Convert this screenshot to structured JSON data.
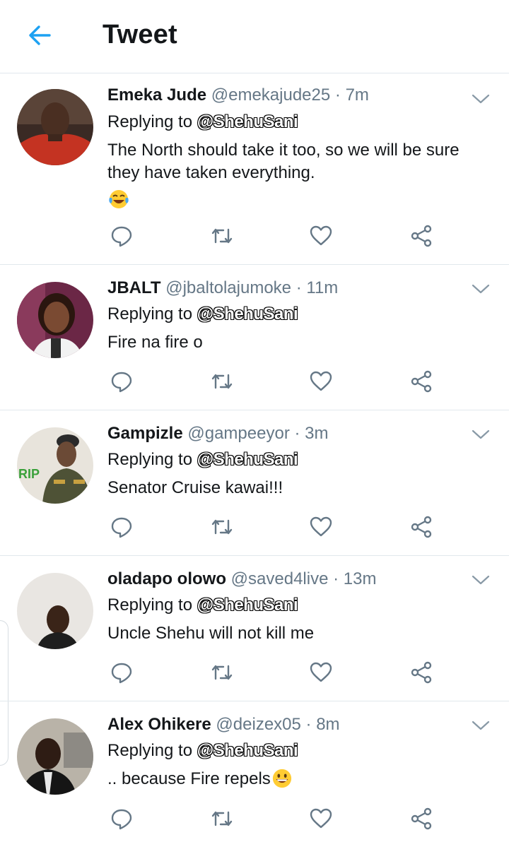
{
  "header": {
    "title": "Tweet"
  },
  "colors": {
    "accent": "#1da1f2",
    "secondary_text": "#657786",
    "icon": "#657786"
  },
  "tweets": [
    {
      "name": "Emeka Jude",
      "handle": "@emekajude25",
      "dot": "·",
      "time": "7m",
      "replying_prefix": "Replying to",
      "replying_to": "@ShehuSani",
      "text": "The North should take it too, so we will be sure they have taken everything.",
      "emoji": "face-with-tears-of-joy"
    },
    {
      "name": "JBALT",
      "handle": "@jbaltolajumoke",
      "dot": "·",
      "time": "11m",
      "replying_prefix": "Replying to",
      "replying_to": "@ShehuSani",
      "text": "Fire na fire o"
    },
    {
      "name": "Gampizle",
      "handle": "@gampeeyor",
      "dot": "·",
      "time": "3m",
      "replying_prefix": "Replying to",
      "replying_to": "@ShehuSani",
      "text": "Senator Cruise kawai!!!"
    },
    {
      "name": "oladapo olowo",
      "handle": "@saved4live",
      "dot": "·",
      "time": "13m",
      "replying_prefix": "Replying to",
      "replying_to": "@ShehuSani",
      "text": "Uncle Shehu will not kill me"
    },
    {
      "name": "Alex Ohikere",
      "handle": "@deizex05",
      "dot": "·",
      "time": "8m",
      "replying_prefix": "Replying to",
      "replying_to": "@ShehuSani",
      "text": ".. because Fire repels",
      "emoji": "grinning-face"
    }
  ],
  "icons": {
    "back": "arrow-left-icon",
    "menu": "chevron-down-icon",
    "reply": "reply-icon",
    "retweet": "retweet-icon",
    "like": "heart-icon",
    "share": "share-icon"
  }
}
